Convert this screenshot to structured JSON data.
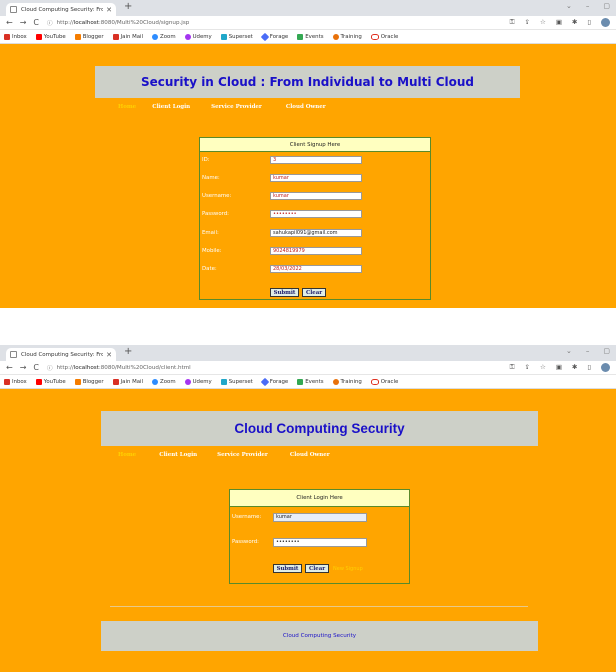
{
  "screen1": {
    "tab_title": "Cloud Computing Security: From",
    "url_prefix": "http://",
    "url_host": "localhost",
    "url_rest": ":8080/Multi%20Cloud/signup.jsp",
    "bookmarks": [
      "Inbox",
      "YouTube",
      "Blogger",
      "Jain Mail",
      "Zoom",
      "Udemy",
      "Superset",
      "Forage",
      "Events",
      "Training",
      "Oracle"
    ],
    "banner_title": "Security in Cloud : From Individual to Multi Cloud",
    "menu": [
      "Home",
      "Client Login",
      "Service Provider",
      "Cloud Owner"
    ],
    "form": {
      "heading": "Client Signup Here",
      "rows": [
        {
          "label": "ID:",
          "value": "3"
        },
        {
          "label": "Name:",
          "value": "kumar"
        },
        {
          "label": "Username:",
          "value": "kumar"
        },
        {
          "label": "Password:",
          "value": "••••••••"
        },
        {
          "label": "Email:",
          "value": "sahukapil091@gmail.com"
        },
        {
          "label": "Mobile:",
          "value": "9024819979"
        },
        {
          "label": "Date:",
          "value": "28/03/2022"
        }
      ],
      "submit": "Submit",
      "clear": "Clear"
    }
  },
  "screen2": {
    "tab_title": "Cloud Computing Security: From",
    "url_prefix": "http://",
    "url_host": "localhost",
    "url_rest": ":8080/Multi%20Cloud/client.html",
    "bookmarks": [
      "Inbox",
      "YouTube",
      "Blogger",
      "Jain Mail",
      "Zoom",
      "Udemy",
      "Superset",
      "Forage",
      "Events",
      "Training",
      "Oracle"
    ],
    "banner_title": "Cloud Computing Security",
    "menu": [
      "Home",
      "Client Login",
      "Service Provider",
      "Cloud Owner"
    ],
    "form": {
      "heading": "Client Login Here",
      "rows": [
        {
          "label": "Username:",
          "value": "kumar"
        },
        {
          "label": "Password:",
          "value": "••••••••"
        }
      ],
      "submit": "Submit",
      "clear": "Clear",
      "signup_link": "New Signup"
    },
    "footer": "Cloud Computing Security"
  },
  "colors": {
    "page_bg": "#ffa500",
    "banner_bg": "#cdd0c8",
    "title_blue": "#1a10c8",
    "form_head_bg": "#ffffc0"
  },
  "icons": [
    "back-arrow-icon",
    "forward-arrow-icon",
    "reload-icon",
    "info-icon",
    "key-icon",
    "share-icon",
    "star-icon",
    "extension-icon",
    "puzzle-icon",
    "sidebar-icon",
    "profile-avatar-icon"
  ]
}
